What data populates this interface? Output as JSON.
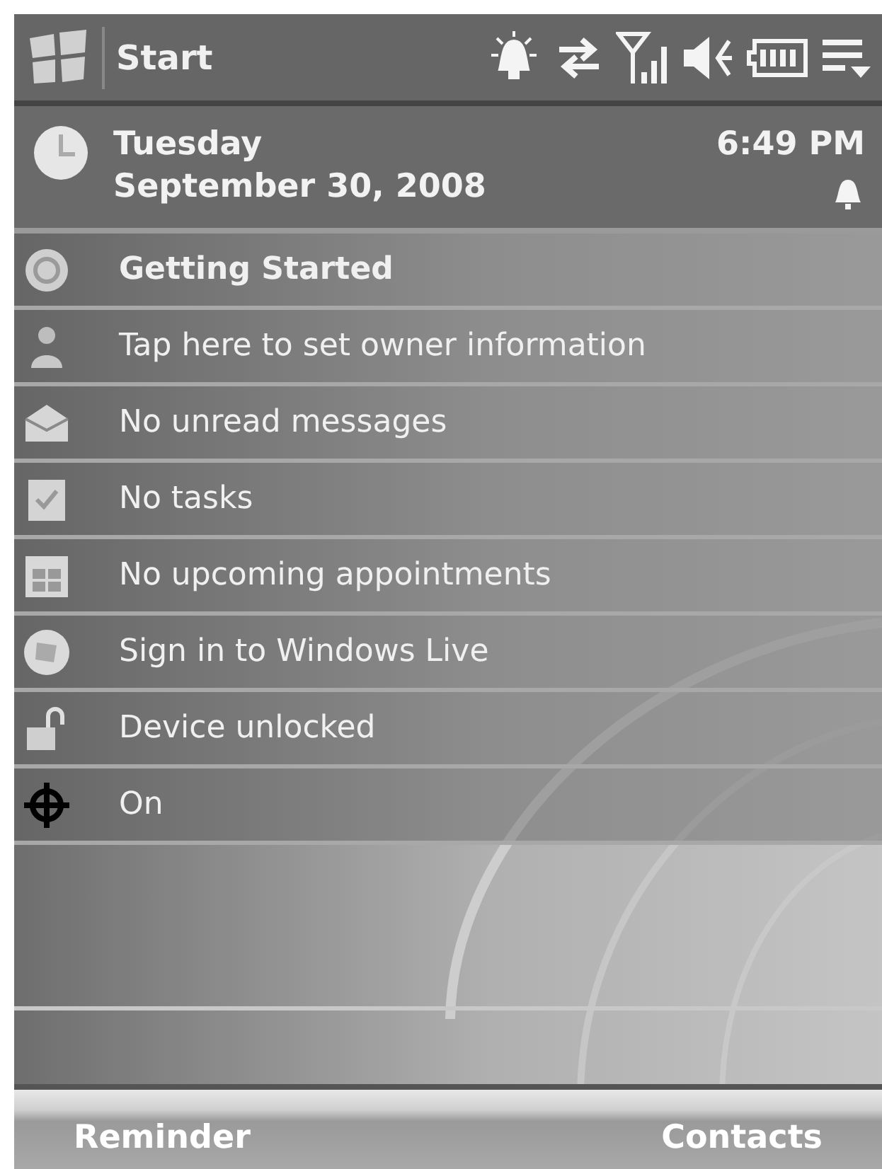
{
  "title_bar": {
    "start_label": "Start"
  },
  "date_panel": {
    "day": "Tuesday",
    "date": "September 30, 2008",
    "time": "6:49 PM"
  },
  "today_items": [
    {
      "text": "Getting Started",
      "emphasis": true
    },
    {
      "text": "Tap here to set owner information",
      "emphasis": false
    },
    {
      "text": "No unread messages",
      "emphasis": false
    },
    {
      "text": "No tasks",
      "emphasis": false
    },
    {
      "text": "No upcoming appointments",
      "emphasis": false
    },
    {
      "text": "Sign in to Windows Live",
      "emphasis": false
    },
    {
      "text": "Device unlocked",
      "emphasis": false
    },
    {
      "text": "On",
      "emphasis": false
    }
  ],
  "soft_keys": {
    "left": "Reminder",
    "right": "Contacts"
  }
}
